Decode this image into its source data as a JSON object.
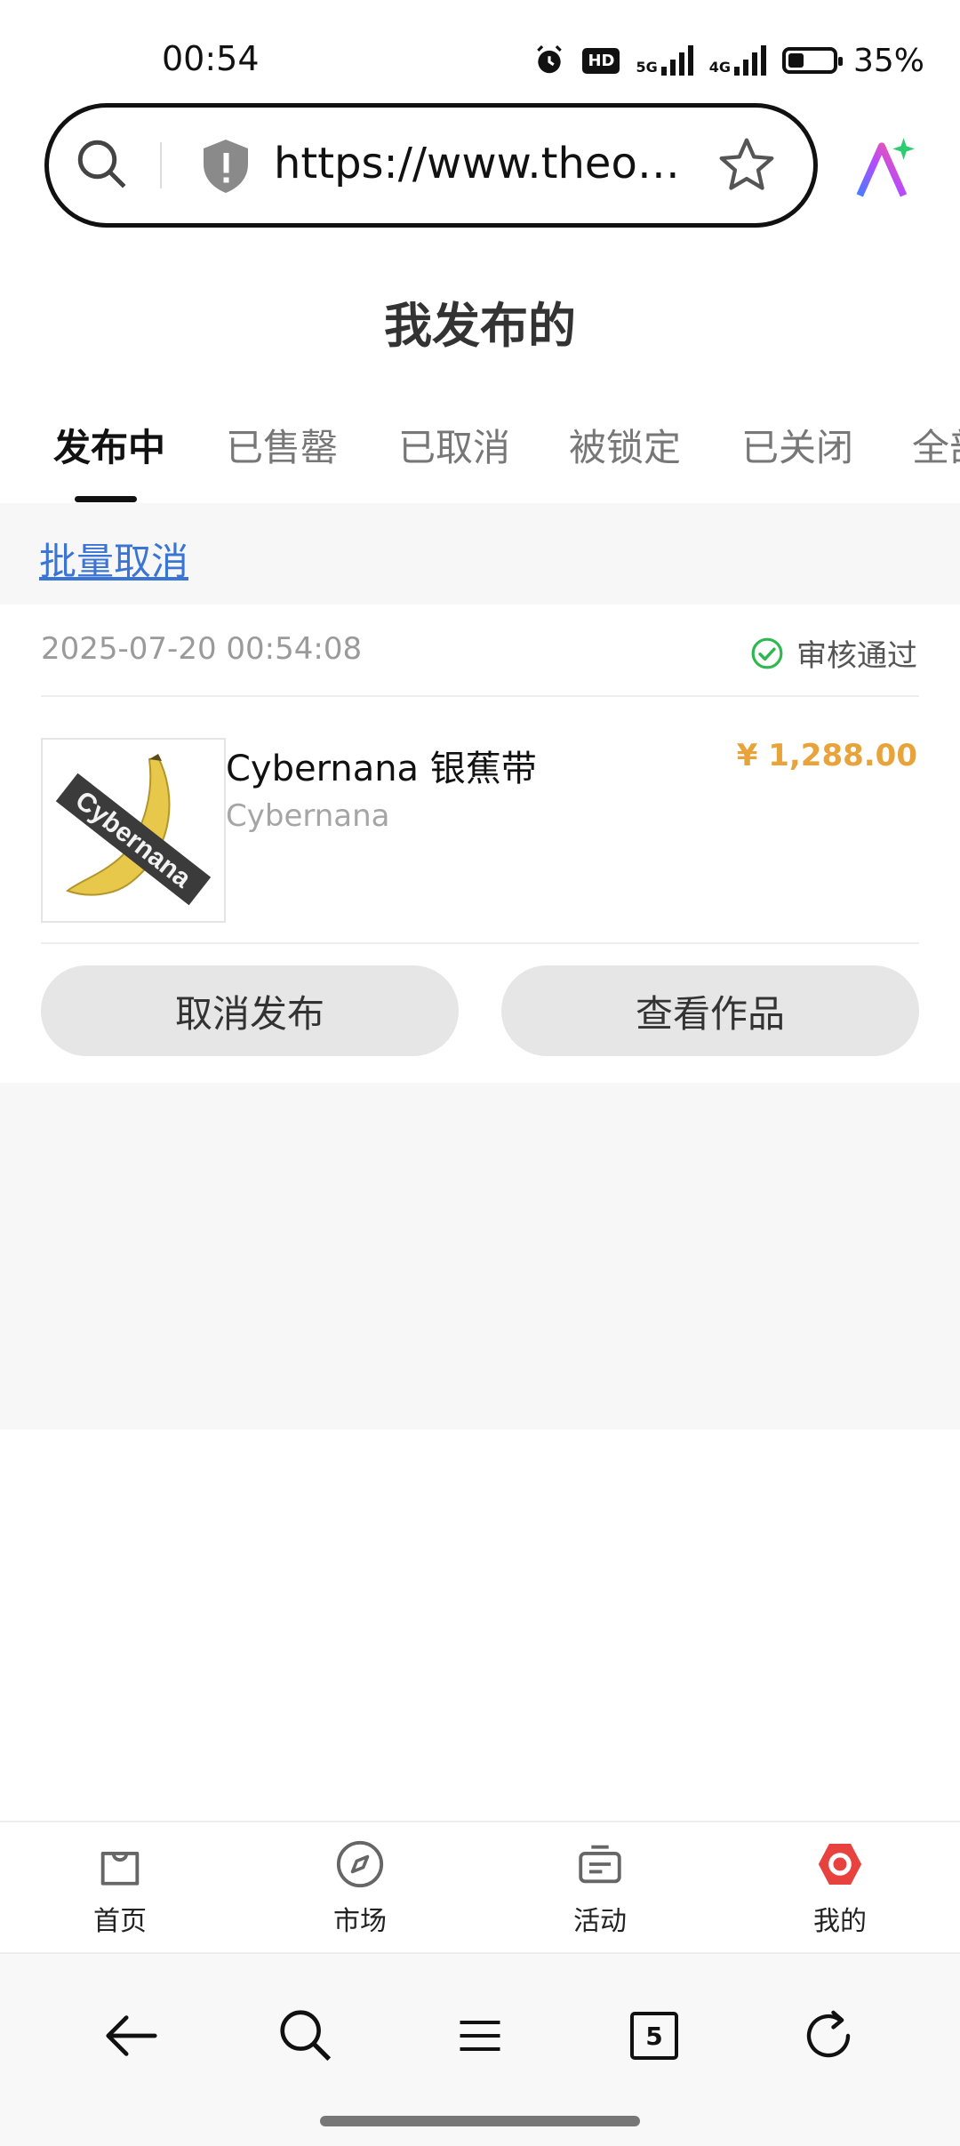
{
  "status_bar": {
    "time": "00:54",
    "network_5g": "5G",
    "network_4g": "4G",
    "battery": "35%",
    "battery_level": 0.35,
    "hd_badge": "HD"
  },
  "browser": {
    "url": "https://www.theone...",
    "tab_count": "5"
  },
  "page": {
    "title": "我发布的",
    "tabs": [
      "发布中",
      "已售罄",
      "已取消",
      "被锁定",
      "已关闭",
      "全部"
    ],
    "active_tab": 0,
    "batch_cancel": "批量取消"
  },
  "listing": {
    "date": "2025-07-20 00:54:08",
    "status": "审核通过",
    "product_name": "Cybernana 银蕉带",
    "product_sub": "Cybernana",
    "price": "¥ 1,288.00",
    "thumb_text": "Cybernana",
    "cancel_button": "取消发布",
    "view_button": "查看作品"
  },
  "site_nav": [
    {
      "label": "首页",
      "icon": "bag-icon"
    },
    {
      "label": "市场",
      "icon": "compass-icon"
    },
    {
      "label": "活动",
      "icon": "ticket-icon"
    },
    {
      "label": "我的",
      "icon": "profile-hexagon-icon"
    }
  ],
  "colors": {
    "accent_price": "#e8a33a",
    "link": "#3a74d4",
    "success": "#2fb84f",
    "active_nav": "#e8423f"
  }
}
